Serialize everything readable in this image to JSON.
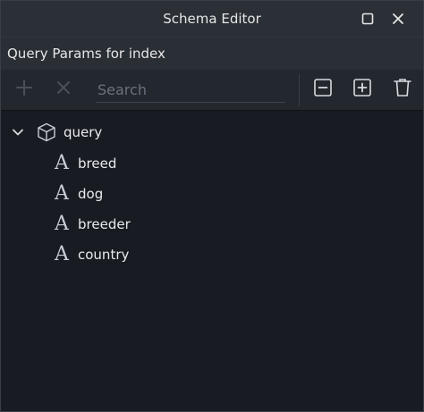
{
  "window": {
    "title": "Schema Editor",
    "controls": {
      "maximize_icon": "square-icon",
      "close_icon": "x-icon"
    }
  },
  "subheader": {
    "text": "Query Params for index"
  },
  "toolbar": {
    "add_icon": "plus-icon",
    "remove_icon": "x-icon",
    "search": {
      "placeholder": "Search",
      "value": ""
    },
    "collapse_icon": "minus-box-icon",
    "expand_icon": "plus-box-icon",
    "delete_icon": "trash-icon"
  },
  "tree": {
    "root": {
      "label": "query",
      "icon": "cube-icon",
      "expanded": true
    },
    "fields": [
      {
        "label": "breed",
        "icon_glyph": "A"
      },
      {
        "label": "dog",
        "icon_glyph": "A"
      },
      {
        "label": "breeder",
        "icon_glyph": "A"
      },
      {
        "label": "country",
        "icon_glyph": "A"
      }
    ]
  },
  "colors": {
    "background": "#181b21",
    "titlebar": "#2b2f36",
    "text": "#e9ebef",
    "muted": "#6b727c"
  }
}
